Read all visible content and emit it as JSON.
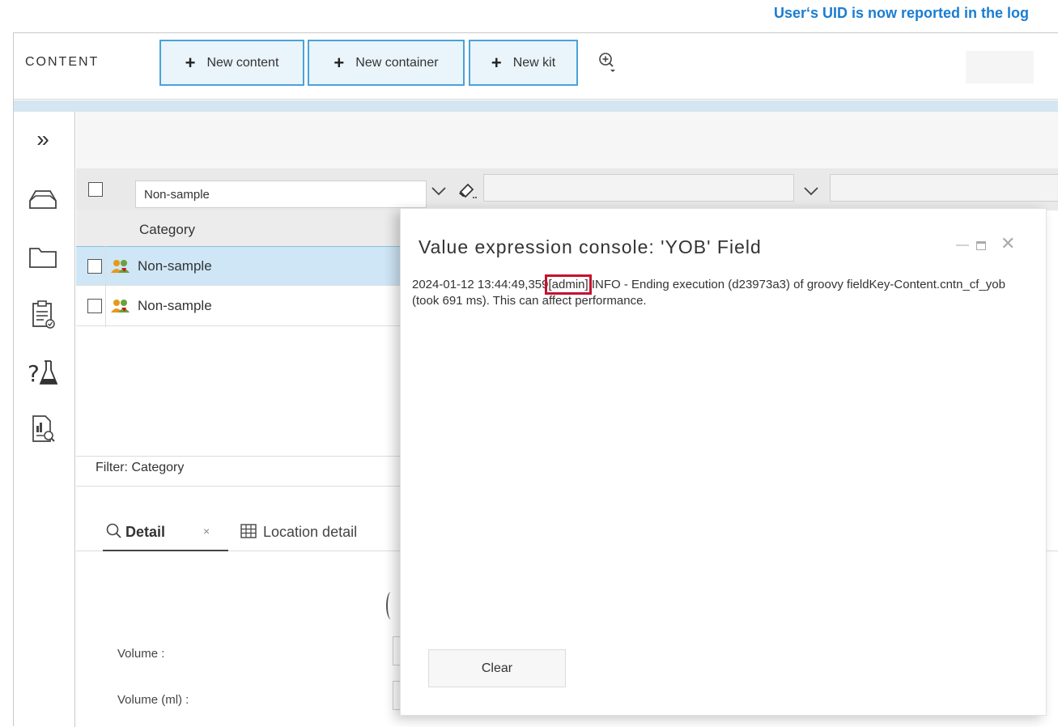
{
  "annotation": "User‘s UID is now reported in the log",
  "header": {
    "title": "CONTENT",
    "buttons": {
      "new_content": "New content",
      "new_container": "New container",
      "new_kit": "New kit"
    },
    "plus_glyph": "+"
  },
  "sidebar": {
    "icons": [
      "expand-icon",
      "container-icon",
      "folder-icon",
      "clipboard-check-icon",
      "question-flask-icon",
      "report-search-icon"
    ],
    "expand_glyph": "»"
  },
  "filter_row": {
    "select_value": "Non-sample"
  },
  "table": {
    "column_header": "Category",
    "rows": [
      {
        "label": "Non-sample",
        "selected": true
      },
      {
        "label": "Non-sample",
        "selected": false
      }
    ],
    "filter_label": "Filter: Category"
  },
  "tabs": {
    "detail": "Detail",
    "location_detail": "Location detail"
  },
  "detail": {
    "volume_label": "Volume :",
    "volume_ml_label": "Volume (ml) :"
  },
  "dialog": {
    "title": "Value expression console: 'YOB' Field",
    "log": {
      "timestamp": "2024-01-12 13:44:49,359",
      "user": "[admin]",
      "message": " INFO - Ending execution (d23973a3) of groovy fieldKey-Content.cntn_cf_yob (took 691 ms). This can affect performance."
    },
    "clear_button": "Clear"
  },
  "colors": {
    "accent_blue": "#1a7dd1",
    "button_border": "#4aa3d8",
    "selected_row": "#cfe6f6",
    "highlight_red": "#c8102e"
  }
}
